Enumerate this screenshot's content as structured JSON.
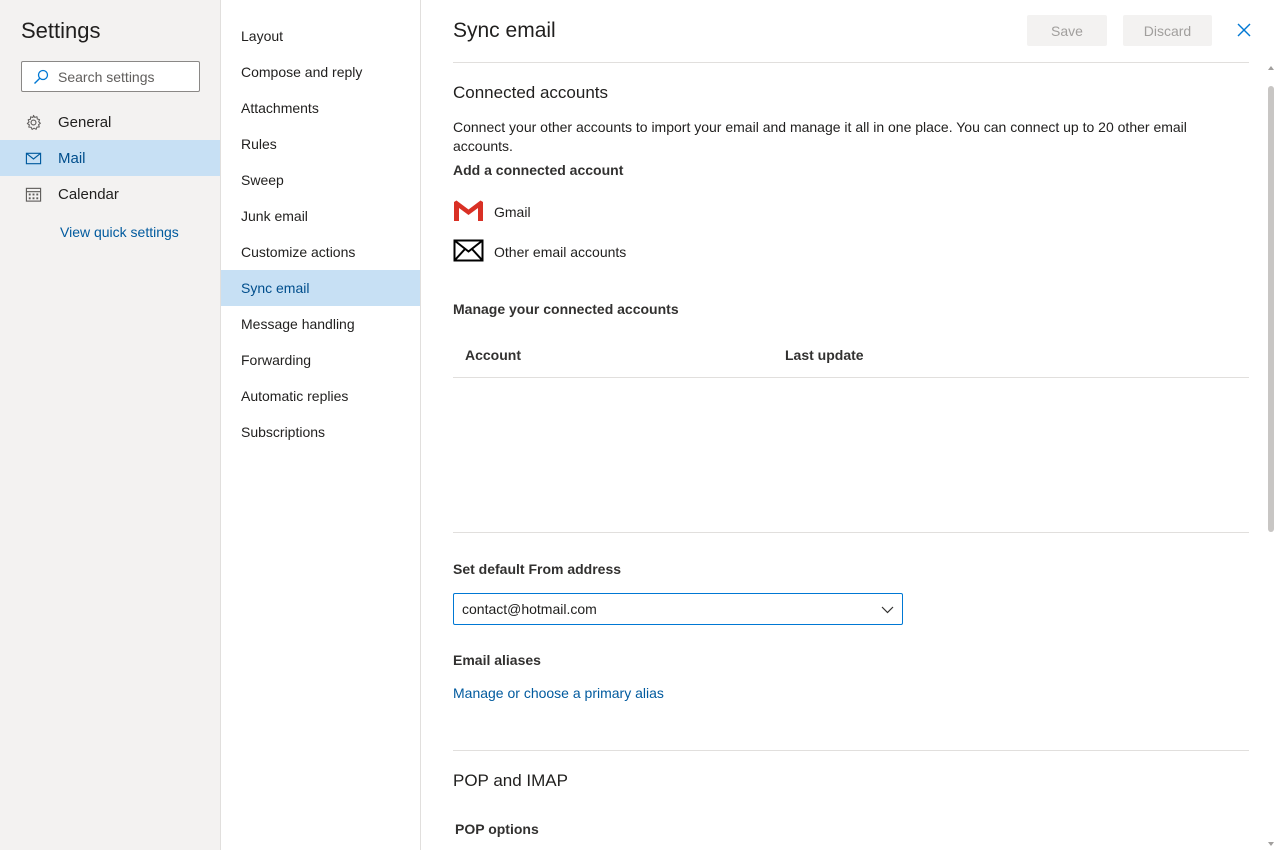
{
  "left": {
    "title": "Settings",
    "search_placeholder": "Search settings",
    "items": [
      {
        "label": "General",
        "icon": "gear-icon"
      },
      {
        "label": "Mail",
        "icon": "mail-icon",
        "active": true
      },
      {
        "label": "Calendar",
        "icon": "calendar-icon"
      }
    ],
    "quick_settings_link": "View quick settings"
  },
  "middle": {
    "items": [
      {
        "label": "Layout"
      },
      {
        "label": "Compose and reply"
      },
      {
        "label": "Attachments"
      },
      {
        "label": "Rules"
      },
      {
        "label": "Sweep"
      },
      {
        "label": "Junk email"
      },
      {
        "label": "Customize actions"
      },
      {
        "label": "Sync email",
        "active": true
      },
      {
        "label": "Message handling"
      },
      {
        "label": "Forwarding"
      },
      {
        "label": "Automatic replies"
      },
      {
        "label": "Subscriptions"
      }
    ]
  },
  "content": {
    "title": "Sync email",
    "save_label": "Save",
    "discard_label": "Discard",
    "connected": {
      "title": "Connected accounts",
      "description": "Connect your other accounts to import your email and manage it all in one place. You can connect up to 20 other email accounts.",
      "add_label": "Add a connected account",
      "gmail_label": "Gmail",
      "other_label": "Other email accounts",
      "manage_label": "Manage your connected accounts",
      "columns": [
        "Account",
        "Last update"
      ]
    },
    "default_from": {
      "label": "Set default From address",
      "value": "contact@hotmail.com"
    },
    "aliases": {
      "label": "Email aliases",
      "link": "Manage or choose a primary alias"
    },
    "pop": {
      "title": "POP and IMAP",
      "options_label": "POP options"
    }
  },
  "colors": {
    "accent": "#0078d4",
    "active_bg": "#c7e0f4",
    "link": "#005a9e",
    "gmail_red": "#d93025"
  }
}
